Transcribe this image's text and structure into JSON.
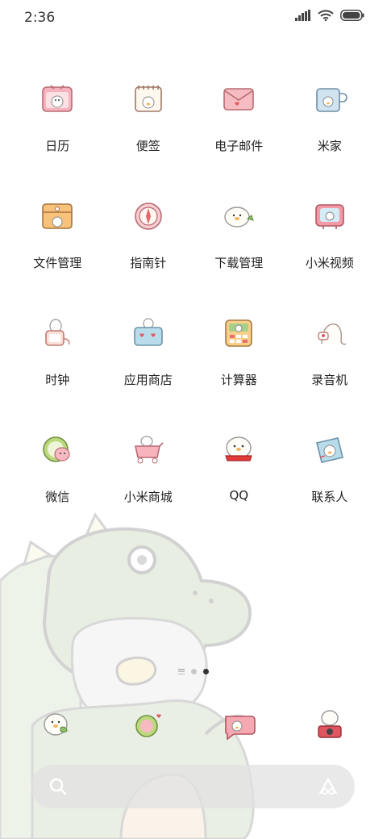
{
  "status_bar": {
    "time": "2:36",
    "signal_icon": "signal-bars-icon",
    "wifi_icon": "wifi-icon",
    "battery_icon": "battery-icon"
  },
  "apps": [
    {
      "label": "日历",
      "icon": "calendar-icon"
    },
    {
      "label": "便签",
      "icon": "notes-icon"
    },
    {
      "label": "电子邮件",
      "icon": "email-icon"
    },
    {
      "label": "米家",
      "icon": "mi-home-icon"
    },
    {
      "label": "文件管理",
      "icon": "file-manager-icon"
    },
    {
      "label": "指南针",
      "icon": "compass-icon"
    },
    {
      "label": "下载管理",
      "icon": "download-manager-icon"
    },
    {
      "label": "小米视频",
      "icon": "mi-video-icon"
    },
    {
      "label": "时钟",
      "icon": "clock-icon"
    },
    {
      "label": "应用商店",
      "icon": "app-store-icon"
    },
    {
      "label": "计算器",
      "icon": "calculator-icon"
    },
    {
      "label": "录音机",
      "icon": "recorder-icon"
    },
    {
      "label": "微信",
      "icon": "wechat-icon"
    },
    {
      "label": "小米商城",
      "icon": "mi-store-icon"
    },
    {
      "label": "QQ",
      "icon": "qq-icon"
    },
    {
      "label": "联系人",
      "icon": "contacts-icon"
    }
  ],
  "page_indicator": {
    "pages": 2,
    "active": 2
  },
  "dock": [
    {
      "icon": "phone-icon"
    },
    {
      "icon": "messages-icon"
    },
    {
      "icon": "browser-icon"
    },
    {
      "icon": "camera-icon"
    }
  ],
  "search_bar": {
    "search_icon": "search-icon",
    "assistant_icon": "assistant-icon"
  },
  "colors": {
    "background": "#ffffff",
    "wallpaper_dino": "#e6ede0",
    "search_bar": "#e1e1e1"
  }
}
